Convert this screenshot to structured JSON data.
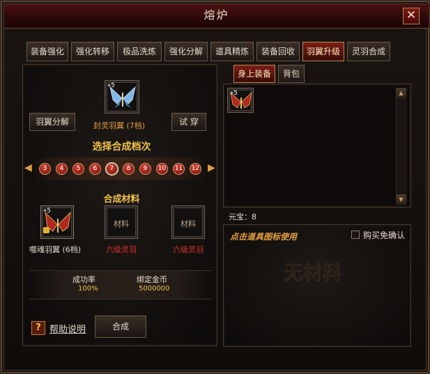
{
  "window": {
    "title": "熔炉",
    "close_glyph": "✕"
  },
  "tabs": [
    {
      "label": "装备强化",
      "active": false
    },
    {
      "label": "强化转移",
      "active": false
    },
    {
      "label": "极品洗炼",
      "active": false
    },
    {
      "label": "强化分解",
      "active": false
    },
    {
      "label": "道具精炼",
      "active": false
    },
    {
      "label": "装备回收",
      "active": false
    },
    {
      "label": "羽翼升级",
      "active": true
    },
    {
      "label": "灵羽合成",
      "active": false
    }
  ],
  "left": {
    "decompose_label": "羽翼分解",
    "target_item": {
      "plus": "+5",
      "name": "封灵羽翼 (7档)"
    },
    "try_on_label": "试 穿",
    "select_tier_title": "选择合成档次",
    "tiers": [
      "3",
      "4",
      "5",
      "6",
      "7",
      "8",
      "9",
      "10",
      "11",
      "12"
    ],
    "selected_tier": "7",
    "materials_title": "合成材料",
    "materials": [
      {
        "plus": "+5",
        "name": "噬魂羽翼 (6档)",
        "slot_label": ""
      },
      {
        "plus": "",
        "name": "六级灵羽",
        "slot_label": "材料"
      },
      {
        "plus": "",
        "name": "六级灵羽",
        "slot_label": "材料"
      }
    ],
    "stats": {
      "success_label": "成功率",
      "success_value": "100%",
      "gold_label": "绑定金币",
      "gold_value": "5000000"
    },
    "help_label": "帮助说明",
    "synth_label": "合成"
  },
  "right": {
    "tabs": [
      {
        "label": "身上装备",
        "active": true
      },
      {
        "label": "背包",
        "active": false
      }
    ],
    "inventory": [
      {
        "plus": "+5"
      }
    ],
    "yuanbao_label": "元宝：",
    "yuanbao_value": "8",
    "hint": "点击道具图标使用",
    "checkbox_label": "购买免确认",
    "empty_text": "无材料"
  },
  "colors": {
    "accent_red": "#c8322a",
    "gold_text": "#f0c34a",
    "orange_text": "#e6a040",
    "material_red": "#e0302a"
  }
}
